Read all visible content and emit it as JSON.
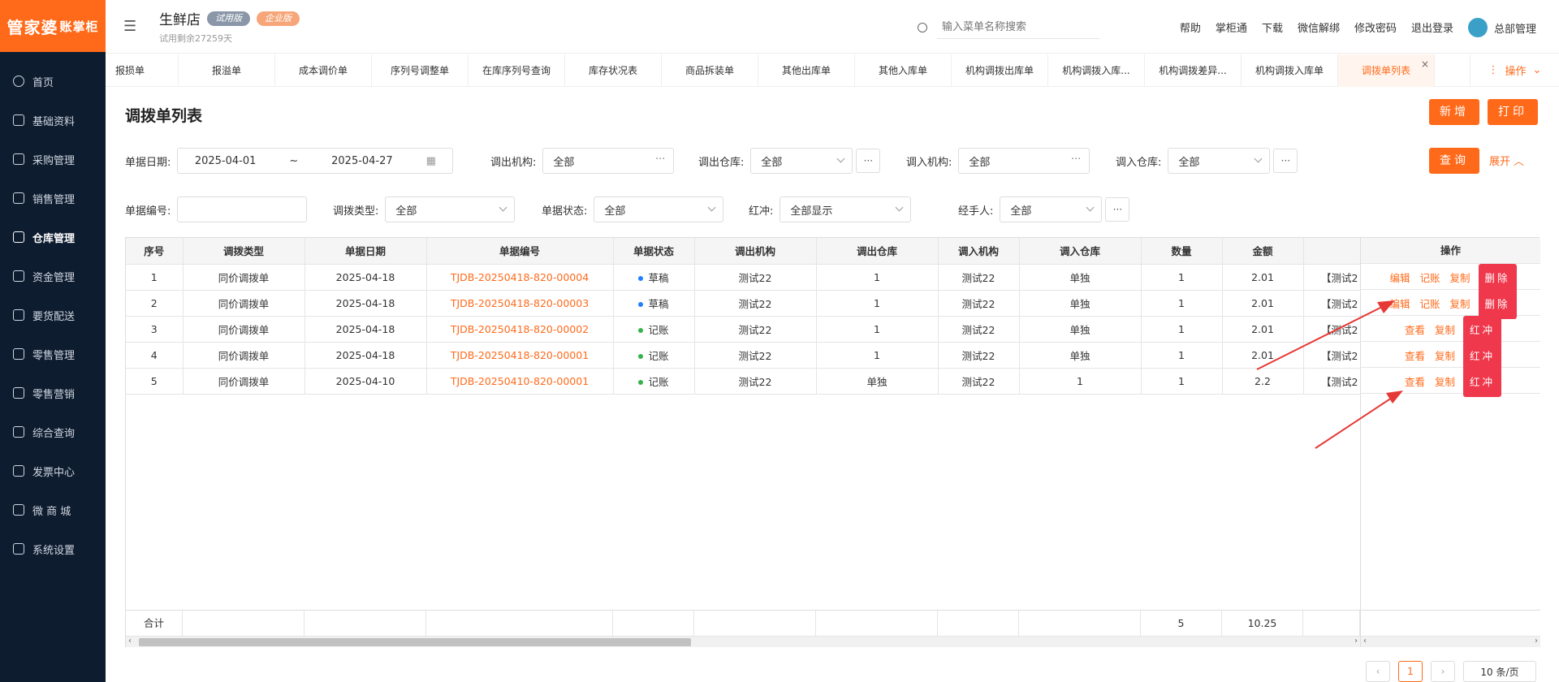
{
  "app": {
    "logo": "管家婆",
    "logo_suffix": "账掌柜"
  },
  "sidebar": {
    "items": [
      {
        "label": "首页",
        "icon": "globe-icon"
      },
      {
        "label": "基础资料",
        "icon": "home-icon"
      },
      {
        "label": "采购管理",
        "icon": "cart-icon"
      },
      {
        "label": "销售管理",
        "icon": "sale-icon"
      },
      {
        "label": "仓库管理",
        "icon": "warehouse-icon",
        "active": true
      },
      {
        "label": "资金管理",
        "icon": "fund-icon"
      },
      {
        "label": "要货配送",
        "icon": "delivery-icon"
      },
      {
        "label": "零售管理",
        "icon": "retail-icon"
      },
      {
        "label": "零售营销",
        "icon": "gift-icon"
      },
      {
        "label": "综合查询",
        "icon": "chart-icon"
      },
      {
        "label": "发票中心",
        "icon": "invoice-icon"
      },
      {
        "label": "微 商 城",
        "icon": "shop-icon"
      },
      {
        "label": "系统设置",
        "icon": "gear-icon"
      }
    ]
  },
  "header": {
    "store_name": "生鲜店",
    "tag_trial": "试用版",
    "tag_pro": "企业版",
    "trial_days": "试用剩余27259天",
    "search_placeholder": "输入菜单名称搜索",
    "links": [
      "帮助",
      "掌柜通",
      "下载",
      "微信解绑",
      "修改密码",
      "退出登录"
    ],
    "user": "总部管理"
  },
  "tabs": {
    "items": [
      "报损单",
      "报溢单",
      "成本调价单",
      "序列号调整单",
      "在库序列号查询",
      "库存状况表",
      "商品拆装单",
      "其他出库单",
      "其他入库单",
      "机构调拨出库单",
      "机构调拨入库...",
      "机构调拨差异...",
      "机构调拨入库单",
      "调拨单列表"
    ],
    "active_index": 13,
    "ops_label": "操作"
  },
  "page": {
    "title": "调拨单列表",
    "btn_new": "新增",
    "btn_print": "打印",
    "btn_query": "查询",
    "expand": "展开"
  },
  "filters": {
    "date_label": "单据日期:",
    "date_from": "2025-04-01",
    "date_sep": "~",
    "date_to": "2025-04-27",
    "out_org_label": "调出机构:",
    "out_org": "全部",
    "out_wh_label": "调出仓库:",
    "out_wh": "全部",
    "in_org_label": "调入机构:",
    "in_org": "全部",
    "in_wh_label": "调入仓库:",
    "in_wh": "全部",
    "no_label": "单据编号:",
    "no_value": "",
    "type_label": "调拨类型:",
    "type": "全部",
    "status_label": "单据状态:",
    "status": "全部",
    "red_label": "红冲:",
    "red": "全部显示",
    "handler_label": "经手人:",
    "handler": "全部"
  },
  "table": {
    "headers": [
      "序号",
      "调拨类型",
      "单据日期",
      "单据编号",
      "单据状态",
      "调出机构",
      "调出仓库",
      "调入机构",
      "调入仓库",
      "数量",
      "金额",
      "",
      "操作"
    ],
    "rows": [
      {
        "idx": "1",
        "type": "同价调拨单",
        "date": "2025-04-18",
        "no": "TJDB-20250418-820-00004",
        "status": "草稿",
        "status_color": "#1e80ff",
        "out_org": "测试22",
        "out_wh": "1",
        "in_org": "测试22",
        "in_wh": "单独",
        "qty": "1",
        "amount": "2.01",
        "extra": "【测试2",
        "actions": [
          "编辑",
          "记账",
          "复制"
        ],
        "red_action": "删除"
      },
      {
        "idx": "2",
        "type": "同价调拨单",
        "date": "2025-04-18",
        "no": "TJDB-20250418-820-00003",
        "status": "草稿",
        "status_color": "#1e80ff",
        "out_org": "测试22",
        "out_wh": "1",
        "in_org": "测试22",
        "in_wh": "单独",
        "qty": "1",
        "amount": "2.01",
        "extra": "【测试2",
        "actions": [
          "编辑",
          "记账",
          "复制"
        ],
        "red_action": "删除"
      },
      {
        "idx": "3",
        "type": "同价调拨单",
        "date": "2025-04-18",
        "no": "TJDB-20250418-820-00002",
        "status": "记账",
        "status_color": "#35b34a",
        "out_org": "测试22",
        "out_wh": "1",
        "in_org": "测试22",
        "in_wh": "单独",
        "qty": "1",
        "amount": "2.01",
        "extra": "【测试2",
        "actions": [
          "查看",
          "复制"
        ],
        "red_action": "红冲"
      },
      {
        "idx": "4",
        "type": "同价调拨单",
        "date": "2025-04-18",
        "no": "TJDB-20250418-820-00001",
        "status": "记账",
        "status_color": "#35b34a",
        "out_org": "测试22",
        "out_wh": "1",
        "in_org": "测试22",
        "in_wh": "单独",
        "qty": "1",
        "amount": "2.01",
        "extra": "【测试2",
        "actions": [
          "查看",
          "复制"
        ],
        "red_action": "红冲"
      },
      {
        "idx": "5",
        "type": "同价调拨单",
        "date": "2025-04-10",
        "no": "TJDB-20250410-820-00001",
        "status": "记账",
        "status_color": "#35b34a",
        "out_org": "测试22",
        "out_wh": "单独",
        "in_org": "测试22",
        "in_wh": "1",
        "qty": "1",
        "amount": "2.2",
        "extra": "【测试2",
        "actions": [
          "查看",
          "复制"
        ],
        "red_action": "红冲"
      }
    ],
    "total_label": "合计",
    "total_qty": "5",
    "total_amount": "10.25"
  },
  "pagination": {
    "current": "1",
    "page_size": "10 条/页"
  },
  "colors": {
    "accent": "#ff6a1a",
    "danger": "#f0384c",
    "sidebar": "#0e1c2f",
    "annotation_arrow": "#e53935"
  }
}
